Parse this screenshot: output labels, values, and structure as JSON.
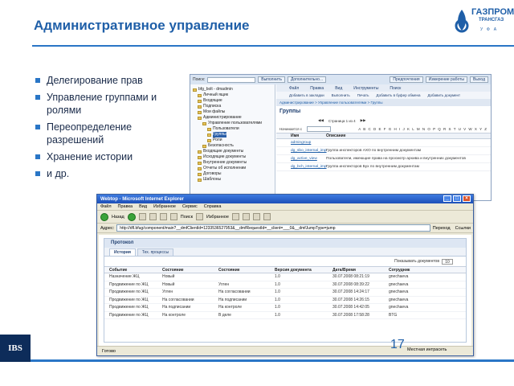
{
  "slide": {
    "title": "Административное управление",
    "page_number": "17",
    "footer_logo": "IBS",
    "logo_text": "ГАЗПРОМ",
    "logo_sub": "ТРАНСГАЗ",
    "logo_city": "УФА",
    "accent_color": "#2a76c6",
    "bullets": [
      "Делегирование прав",
      "Управление группами и ролями",
      "Переопределение разрешений",
      "Хранение истории",
      "и др."
    ]
  },
  "back_window": {
    "search_label": "Поиск:",
    "buttons": [
      "Выполнить",
      "Дополнительно...",
      "Предпочтения",
      "Измерение работы",
      "Выход"
    ],
    "tree": [
      {
        "label": "bfg_bolt - dmadmin",
        "selected": false
      },
      {
        "label": "Личный ящик",
        "selected": false
      },
      {
        "label": "Входящие",
        "selected": false
      },
      {
        "label": "Подписка",
        "selected": false
      },
      {
        "label": "Мои файлы",
        "selected": false
      },
      {
        "label": "Администрирование",
        "selected": false
      },
      {
        "label": "Управление пользователями",
        "selected": false
      },
      {
        "label": "Пользователи",
        "selected": false
      },
      {
        "label": "Группы",
        "selected": true
      },
      {
        "label": "Роли",
        "selected": false
      },
      {
        "label": "Безопасность",
        "selected": false
      },
      {
        "label": "Входящие документы",
        "selected": false
      },
      {
        "label": "Исходящие документы",
        "selected": false
      },
      {
        "label": "Внутренние документы",
        "selected": false
      },
      {
        "label": "Отчеты об исполнении",
        "selected": false
      },
      {
        "label": "Договоры",
        "selected": false
      },
      {
        "label": "Шаблоны",
        "selected": false
      }
    ],
    "menu": [
      "Файл",
      "Правка",
      "Вид",
      "Инструменты",
      "Поиск"
    ],
    "submenu": [
      "Добавить в закладки",
      "Выполнить",
      "Печать",
      "Добавить в буфер обмена",
      "Добавить документ"
    ],
    "breadcrumb": "Администрирование > Управление пользователями > Группы",
    "heading": "Группы",
    "nav_text": "Страница 1 из 4",
    "filter_label": "Начинается с",
    "columns": [
      "Имя",
      "Описание"
    ],
    "rows": [
      {
        "name": "admingroup",
        "desc": ""
      },
      {
        "name": "dg_sbo_internal_imp",
        "desc": "Группа инспекторов АХО по внутренним документам"
      },
      {
        "name": "dg_active_view",
        "desc": "Пользователи, имеющие права на просмотр архива и внутренних документов"
      },
      {
        "name": "dg_bch_internal_imp",
        "desc": "Группа инспекторов Бух по внутренним документам"
      }
    ]
  },
  "front_window": {
    "title": "Webtop - Microsoft Internet Explorer",
    "menu": [
      "Файл",
      "Правка",
      "Вид",
      "Избранное",
      "Сервис",
      "Справка"
    ],
    "toolbar": {
      "back": "Назад",
      "search": "Поиск",
      "favorites": "Избранное"
    },
    "address_label": "Адрес:",
    "url": "http://dfl.bfug/component/main?__dmfClientId=1233536527953&__dmfRequestId=__client=___0&__dmfJumpType=jump",
    "go_label": "Переход",
    "links_label": "Ссылки",
    "panel_title": "Протокол",
    "tabs": [
      "История",
      "Тех. процессы"
    ],
    "per_page_label": "Показывать документов",
    "per_page_value": "10",
    "columns": [
      "Событие",
      "Состояние",
      "Состояние",
      "Версия документа",
      "Дата/Время",
      "Сотрудник"
    ],
    "rows": [
      [
        "Назначение ЖЦ",
        "Новый",
        "",
        "1.0",
        "30.07.2008 08:21:19",
        "gnechaeva"
      ],
      [
        "Продвижение по ЖЦ",
        "Новый",
        "Углен",
        "1.0",
        "30.07.2008 08:39:22",
        "gnechaeva"
      ],
      [
        "Продвижение по ЖЦ",
        "Углен",
        "На согласовании",
        "1.0",
        "30.07.2008 14:24:17",
        "gnechaeva"
      ],
      [
        "Продвижение по ЖЦ",
        "На согласовании",
        "На подписании",
        "1.0",
        "30.07.2008 14:26:15",
        "gnechaeva"
      ],
      [
        "Продвижение по ЖЦ",
        "На подписании",
        "На контроле",
        "1.0",
        "30.07.2008 14:42:05",
        "gnechaeva"
      ],
      [
        "Продвижение по ЖЦ",
        "На контроле",
        "В деле",
        "1.0",
        "30.07.2008 17:58:28",
        "BTG"
      ]
    ],
    "status_left": "Готово",
    "status_zone": "Местная интрасеть"
  }
}
